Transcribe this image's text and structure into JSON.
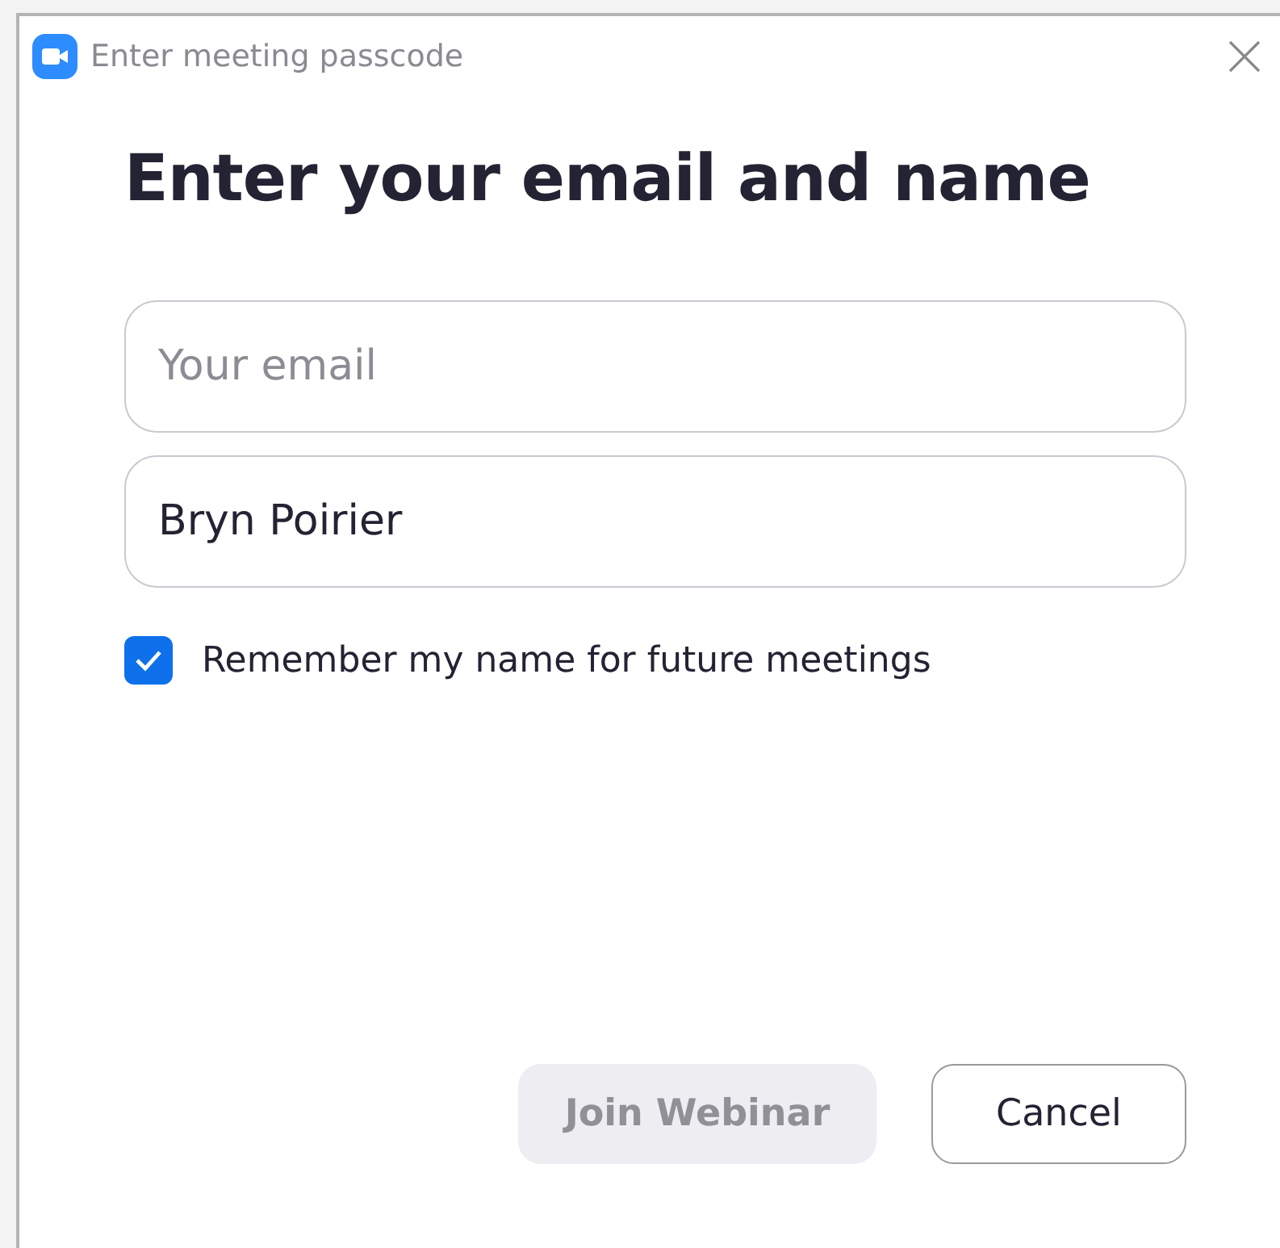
{
  "window": {
    "title": "Enter meeting passcode"
  },
  "heading": "Enter your email and name",
  "fields": [
    {
      "placeholder": "Your email"
    },
    {
      "value": "Bryn Poirier"
    }
  ],
  "remember": {
    "label": "Remember my name for future meetings",
    "checked": true
  },
  "buttons": [
    {
      "label": "Join Webinar",
      "disabled": true
    },
    {
      "label": "Cancel",
      "disabled": false
    }
  ]
}
